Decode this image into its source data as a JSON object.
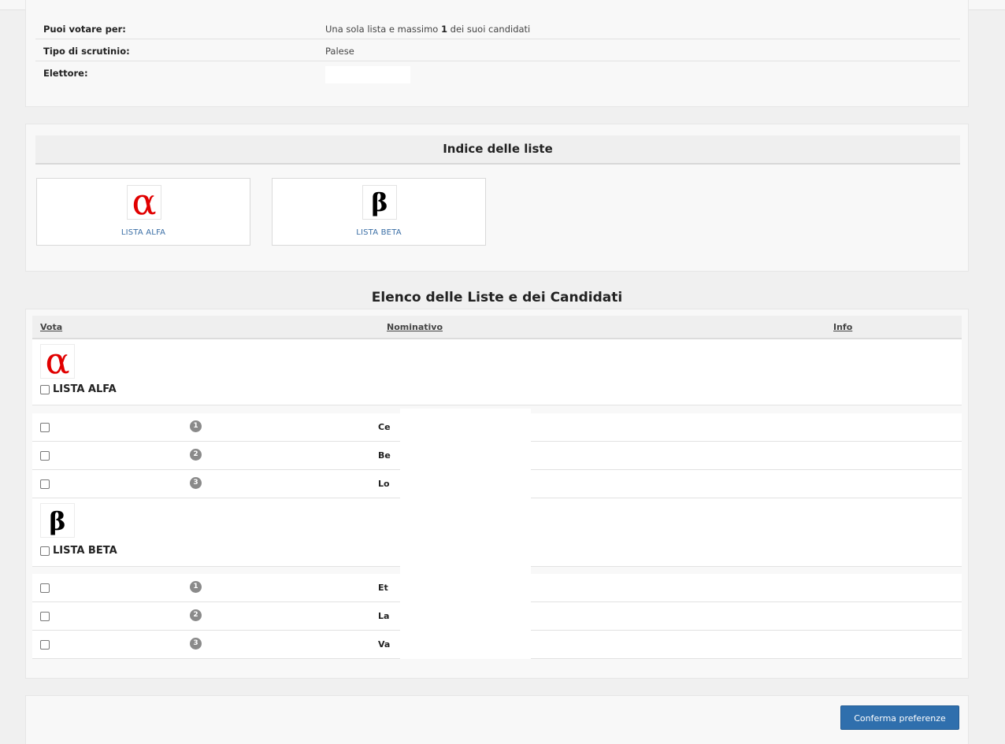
{
  "info": {
    "rows": [
      {
        "key": "Puoi votare per:",
        "value_pre": "Una sola lista e massimo ",
        "value_bold": "1",
        "value_post": " dei suoi candidati"
      },
      {
        "key": "Tipo di scrutinio:",
        "value": "Palese"
      },
      {
        "key": "Elettore:",
        "value": ""
      }
    ]
  },
  "index": {
    "title": "Indice delle liste",
    "lists": [
      {
        "logo": "α",
        "label": "LISTA ALFA",
        "color": "#e10000"
      },
      {
        "logo": "β",
        "label": "LISTA BETA",
        "color": "#000000"
      }
    ]
  },
  "candidates": {
    "title": "Elenco delle Liste e dei Candidati",
    "columns": {
      "vote": "Vota",
      "name": "Nominativo",
      "info": "Info"
    },
    "lists": [
      {
        "logo": "α",
        "name": "LISTA ALFA",
        "checked": false,
        "candidates": [
          {
            "number": "1",
            "name": "Ce",
            "checked": false
          },
          {
            "number": "2",
            "name": "Be",
            "checked": false
          },
          {
            "number": "3",
            "name": "Lo",
            "checked": false
          }
        ]
      },
      {
        "logo": "β",
        "name": "LISTA BETA",
        "checked": false,
        "candidates": [
          {
            "number": "1",
            "name": "Et",
            "checked": false
          },
          {
            "number": "2",
            "name": "La",
            "checked": false
          },
          {
            "number": "3",
            "name": "Va",
            "checked": false
          }
        ]
      }
    ]
  },
  "footer": {
    "confirm_label": "Conferma preferenze"
  },
  "colors": {
    "accent": "#2f6fad",
    "alpha_logo": "#e10000",
    "badge": "#8a8a8a"
  }
}
